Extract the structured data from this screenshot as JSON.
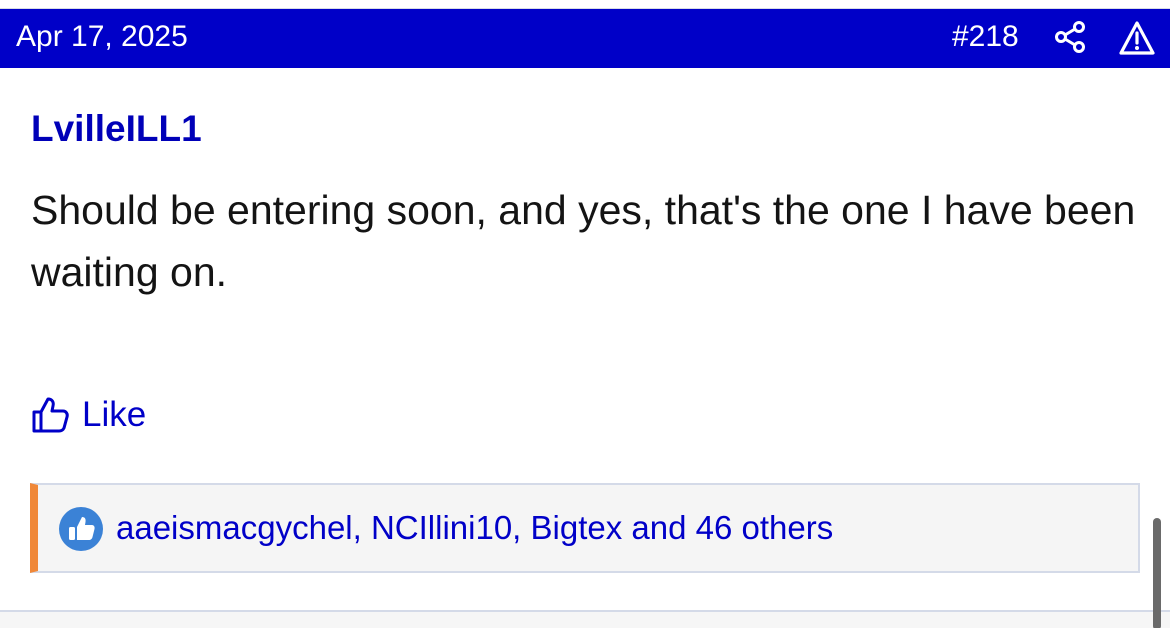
{
  "post": {
    "date": "Apr 17, 2025",
    "number": "#218",
    "author": "LvilleILL1",
    "body": "Should be entering soon, and yes, that's the one I have been waiting on.",
    "like_label": "Like",
    "reactions": {
      "users_text": "aaeismacgychel, NCIllini10, Bigtex and 46 others",
      "icon": "thumbs-up-icon"
    }
  },
  "icons": {
    "share": "share-icon",
    "report": "warning-icon",
    "like": "thumbs-up-icon"
  },
  "colors": {
    "header_bg": "#0000c8",
    "link": "#0000c8",
    "reaction_accent": "#f08838",
    "reaction_badge": "#3b82d6"
  }
}
